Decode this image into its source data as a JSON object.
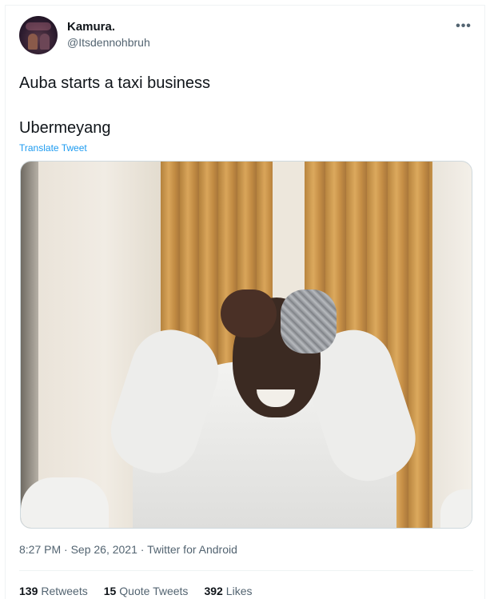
{
  "author": {
    "display_name": "Kamura.",
    "handle": "@Itsdennohbruh"
  },
  "tweet": {
    "line1": "Auba starts a taxi business",
    "line2": "Ubermeyang",
    "translate_label": "Translate Tweet"
  },
  "meta": {
    "timestamp": "8:27 PM · Sep 26, 2021 · Twitter for Android"
  },
  "stats": [
    {
      "count": "139",
      "label": "Retweets"
    },
    {
      "count": "15",
      "label": "Quote Tweets"
    },
    {
      "count": "392",
      "label": "Likes"
    }
  ],
  "colors": {
    "link": "#1d9bf0",
    "secondary_text": "#536471",
    "primary_text": "#0f1419"
  },
  "icons": {
    "more": "more-horizontal-icon"
  }
}
